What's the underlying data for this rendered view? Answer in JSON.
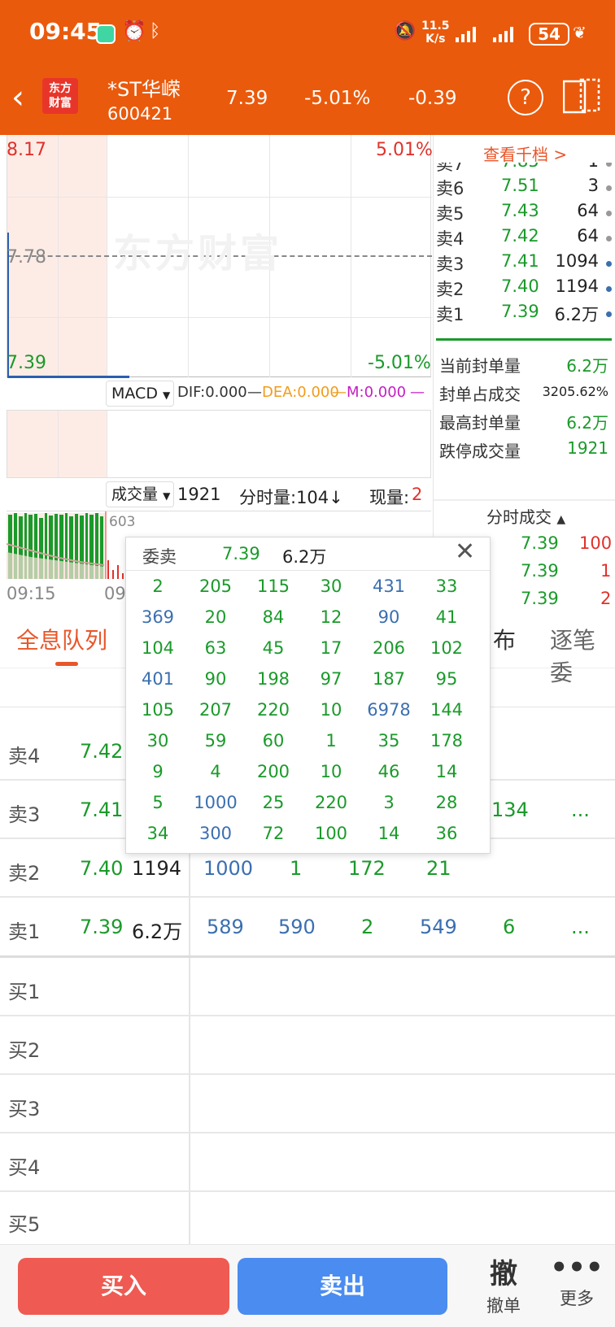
{
  "status": {
    "time": "09:45",
    "net_speed_top": "11.5",
    "net_speed_bottom": "K/s",
    "battery": "54"
  },
  "header": {
    "logo_line1": "东方",
    "logo_line2": "财富",
    "stock_name": "*ST华嵘",
    "stock_code": "600421",
    "price": "7.39",
    "change_pct": "-5.01%",
    "change": "-0.39"
  },
  "chart": {
    "high_price": "8.17",
    "high_pct": "5.01%",
    "mid_price": "7.78",
    "low_price": "7.39",
    "low_pct": "-5.01%",
    "watermark": "东方财富"
  },
  "macd": {
    "selector": "MACD",
    "dif": "DIF:0.000",
    "dea": "DEA:0.000",
    "m": "M:0.000"
  },
  "volume": {
    "selector": "成交量",
    "total": "1921",
    "tick_label": "分时量:104↓",
    "now_label": "现量:",
    "now_value": "2",
    "max_label": "603",
    "time_start": "09:15",
    "time_mid": "09"
  },
  "orderbook": {
    "link": "查看千档 >",
    "rows": [
      {
        "label": "卖7",
        "price": "7.85",
        "vol": "1"
      },
      {
        "label": "卖6",
        "price": "7.51",
        "vol": "3"
      },
      {
        "label": "卖5",
        "price": "7.43",
        "vol": "64"
      },
      {
        "label": "卖4",
        "price": "7.42",
        "vol": "64"
      },
      {
        "label": "卖3",
        "price": "7.41",
        "vol": "1094"
      },
      {
        "label": "卖2",
        "price": "7.40",
        "vol": "1194"
      },
      {
        "label": "卖1",
        "price": "7.39",
        "vol": "6.2万"
      }
    ]
  },
  "seal": [
    {
      "label": "当前封单量",
      "value": "6.2万"
    },
    {
      "label": "封单占成交",
      "value": "3205.62%"
    },
    {
      "label": "最高封单量",
      "value": "6.2万"
    },
    {
      "label": "跌停成交量",
      "value": "1921"
    }
  ],
  "ticks": {
    "title": "分时成交",
    "rows": [
      {
        "price": "7.39",
        "vol": "100"
      },
      {
        "price": "7.39",
        "vol": "1"
      },
      {
        "price": "7.39",
        "vol": "2"
      }
    ]
  },
  "tabs": {
    "active": "全息队列",
    "partial1": "布",
    "partial2": "逐笔委"
  },
  "queue": [
    {
      "label": "卖4",
      "price": "7.42",
      "vol": "",
      "cells": [],
      "extra": ""
    },
    {
      "label": "卖3",
      "price": "7.41",
      "vol": "",
      "cells": [
        "134"
      ],
      "extra": "..."
    },
    {
      "label": "卖2",
      "price": "7.40",
      "vol": "1194",
      "cells": [
        "1000",
        "1",
        "172",
        "21"
      ],
      "extra": ""
    },
    {
      "label": "卖1",
      "price": "7.39",
      "vol": "6.2万",
      "cells": [
        "589",
        "590",
        "2",
        "549",
        "6"
      ],
      "extra": "..."
    },
    {
      "label": "买1"
    },
    {
      "label": "买2"
    },
    {
      "label": "买3"
    },
    {
      "label": "买4"
    },
    {
      "label": "买5"
    }
  ],
  "popup": {
    "title": "委卖",
    "price": "7.39",
    "amount": "6.2万",
    "grid": [
      [
        "2",
        "205",
        "115",
        "30",
        "431",
        "33"
      ],
      [
        "369",
        "20",
        "84",
        "12",
        "90",
        "41"
      ],
      [
        "104",
        "63",
        "45",
        "17",
        "206",
        "102"
      ],
      [
        "401",
        "90",
        "198",
        "97",
        "187",
        "95"
      ],
      [
        "105",
        "207",
        "220",
        "10",
        "6978",
        "144"
      ],
      [
        "30",
        "59",
        "60",
        "1",
        "35",
        "178"
      ],
      [
        "9",
        "4",
        "200",
        "10",
        "46",
        "14"
      ],
      [
        "5",
        "1000",
        "25",
        "220",
        "3",
        "28"
      ],
      [
        "34",
        "300",
        "72",
        "100",
        "14",
        "36"
      ]
    ],
    "blue_cells": [
      [
        0,
        4
      ],
      [
        1,
        0
      ],
      [
        1,
        4
      ],
      [
        3,
        0
      ],
      [
        4,
        4
      ],
      [
        7,
        1
      ],
      [
        8,
        1
      ]
    ]
  },
  "bottom": {
    "buy": "买入",
    "sell": "卖出",
    "cancel_icon": "撤",
    "cancel": "撤单",
    "more": "更多"
  },
  "colors": {
    "brand": "#ea5a0c",
    "up": "#e0322b",
    "down": "#1a9a2a",
    "blue": "#3b6fb0",
    "buy_btn": "#ef5a52",
    "sell_btn": "#4a8cf0"
  }
}
